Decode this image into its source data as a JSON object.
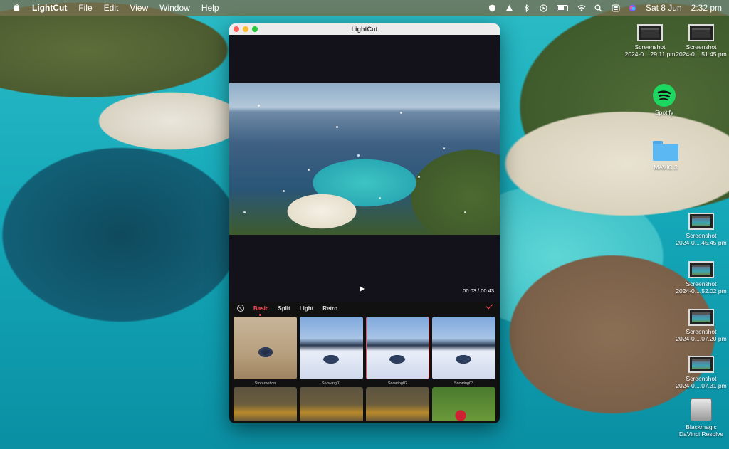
{
  "menubar": {
    "apple": "",
    "app_name": "LightCut",
    "menus": [
      "File",
      "Edit",
      "View",
      "Window",
      "Help"
    ],
    "date": "Sat 8 Jun",
    "time": "2:32 pm"
  },
  "desktop": {
    "icons": [
      {
        "name": "Screenshot",
        "sub": "2024-0....29.11 pm"
      },
      {
        "name": "Screenshot",
        "sub": "2024-0....51.45 pm"
      },
      {
        "name": "Spotify",
        "sub": ""
      },
      {
        "name": "MAVIC 3",
        "sub": ""
      },
      {
        "name": "Screenshot",
        "sub": "2024-0....45.45 pm"
      },
      {
        "name": "Screenshot",
        "sub": "2024-0....52.02 pm"
      },
      {
        "name": "Screenshot",
        "sub": "2024-0....07.20 pm"
      },
      {
        "name": "Screenshot",
        "sub": "2024-0....07.31 pm"
      },
      {
        "name": "Blackmagic",
        "sub": "DaVinci Resolve"
      }
    ]
  },
  "window": {
    "title": "LightCut",
    "playback": {
      "current": "00:03",
      "total": "00:43",
      "separator": " / "
    },
    "tabs": [
      "Basic",
      "Split",
      "Light",
      "Retro"
    ],
    "active_tab": "Basic",
    "effects": [
      {
        "label": "Stop-motion",
        "selected": false
      },
      {
        "label": "Snowing01",
        "selected": false
      },
      {
        "label": "Snowing02",
        "selected": true
      },
      {
        "label": "Snowing03",
        "selected": false
      }
    ]
  },
  "colors": {
    "accent": "#ff4d5e",
    "close": "#fe5f57",
    "minimize": "#febc2e",
    "zoom": "#28c840"
  }
}
